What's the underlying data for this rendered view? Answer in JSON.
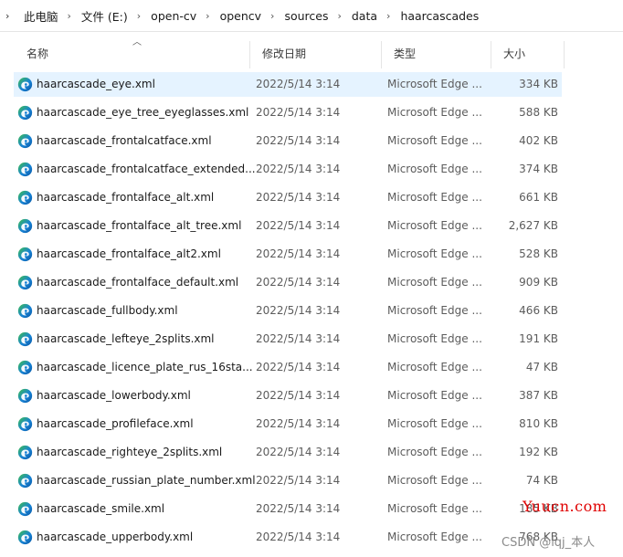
{
  "breadcrumb": [
    "此电脑",
    "文件 (E:)",
    "open-cv",
    "opencv",
    "sources",
    "data",
    "haarcascades"
  ],
  "columns": {
    "name": "名称",
    "date": "修改日期",
    "type": "类型",
    "size": "大小"
  },
  "files": [
    {
      "name": "haarcascade_eye.xml",
      "date": "2022/5/14 3:14",
      "type": "Microsoft Edge ...",
      "size": "334 KB",
      "selected": true
    },
    {
      "name": "haarcascade_eye_tree_eyeglasses.xml",
      "date": "2022/5/14 3:14",
      "type": "Microsoft Edge ...",
      "size": "588 KB"
    },
    {
      "name": "haarcascade_frontalcatface.xml",
      "date": "2022/5/14 3:14",
      "type": "Microsoft Edge ...",
      "size": "402 KB"
    },
    {
      "name": "haarcascade_frontalcatface_extended...",
      "date": "2022/5/14 3:14",
      "type": "Microsoft Edge ...",
      "size": "374 KB"
    },
    {
      "name": "haarcascade_frontalface_alt.xml",
      "date": "2022/5/14 3:14",
      "type": "Microsoft Edge ...",
      "size": "661 KB"
    },
    {
      "name": "haarcascade_frontalface_alt_tree.xml",
      "date": "2022/5/14 3:14",
      "type": "Microsoft Edge ...",
      "size": "2,627 KB"
    },
    {
      "name": "haarcascade_frontalface_alt2.xml",
      "date": "2022/5/14 3:14",
      "type": "Microsoft Edge ...",
      "size": "528 KB"
    },
    {
      "name": "haarcascade_frontalface_default.xml",
      "date": "2022/5/14 3:14",
      "type": "Microsoft Edge ...",
      "size": "909 KB"
    },
    {
      "name": "haarcascade_fullbody.xml",
      "date": "2022/5/14 3:14",
      "type": "Microsoft Edge ...",
      "size": "466 KB"
    },
    {
      "name": "haarcascade_lefteye_2splits.xml",
      "date": "2022/5/14 3:14",
      "type": "Microsoft Edge ...",
      "size": "191 KB"
    },
    {
      "name": "haarcascade_licence_plate_rus_16sta...",
      "date": "2022/5/14 3:14",
      "type": "Microsoft Edge ...",
      "size": "47 KB"
    },
    {
      "name": "haarcascade_lowerbody.xml",
      "date": "2022/5/14 3:14",
      "type": "Microsoft Edge ...",
      "size": "387 KB"
    },
    {
      "name": "haarcascade_profileface.xml",
      "date": "2022/5/14 3:14",
      "type": "Microsoft Edge ...",
      "size": "810 KB"
    },
    {
      "name": "haarcascade_righteye_2splits.xml",
      "date": "2022/5/14 3:14",
      "type": "Microsoft Edge ...",
      "size": "192 KB"
    },
    {
      "name": "haarcascade_russian_plate_number.xml",
      "date": "2022/5/14 3:14",
      "type": "Microsoft Edge ...",
      "size": "74 KB"
    },
    {
      "name": "haarcascade_smile.xml",
      "date": "2022/5/14 3:14",
      "type": "Microsoft Edge ...",
      "size": "185 KB"
    },
    {
      "name": "haarcascade_upperbody.xml",
      "date": "2022/5/14 3:14",
      "type": "Microsoft Edge ...",
      "size": "768 KB"
    }
  ],
  "watermarks": {
    "site": "Yuucn.com",
    "author": "CSDN @lqj_本人"
  },
  "colors": {
    "selected_row": "#e5f3ff",
    "edge_blue": "#1783d6",
    "edge_green": "#3fc04a",
    "watermark_red": "#e00000"
  },
  "icons": {
    "file": "edge-browser-icon",
    "sort": "sort-up-icon",
    "separator": "chevron-right-icon"
  }
}
